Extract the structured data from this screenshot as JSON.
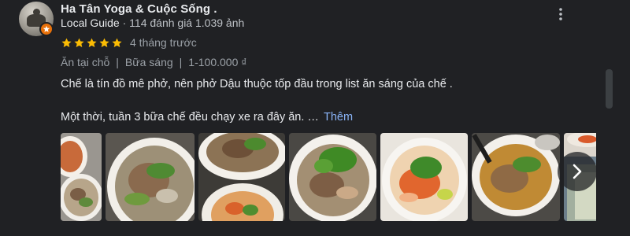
{
  "reviewer": {
    "name": "Ha Tân Yoga & Cuộc Sống .",
    "level": "Local Guide",
    "reviews": "114 đánh giá",
    "photos": "1.039 ảnh",
    "avatar_icon": "person-avatar",
    "badge_icon": "local-guide-star-icon"
  },
  "rating": {
    "stars": 5,
    "out_of": 5,
    "star_color": "#fbbc04",
    "date": "4 tháng trước"
  },
  "tags": {
    "service": "Ăn tại chỗ",
    "meal": "Bữa sáng",
    "price": "1-100.000 ₫"
  },
  "review_text": {
    "line1": "Chế là tín đồ mê phở, nên phở Dậu thuộc tốp đầu trong list ăn sáng của chế .",
    "line2": "Một thời, tuần 3 bữa chế đều chạy xe ra đây ăn. …",
    "more_label": "Thêm",
    "link_color": "#8ab4f8"
  },
  "photos": [
    {
      "icon": "pho-photo"
    },
    {
      "icon": "pho-photo"
    },
    {
      "icon": "pho-photo"
    },
    {
      "icon": "pho-photo"
    },
    {
      "icon": "pho-photo"
    },
    {
      "icon": "pho-photo"
    }
  ],
  "controls": {
    "more_icon": "more-vert-icon",
    "next_icon": "chevron-right-icon"
  }
}
